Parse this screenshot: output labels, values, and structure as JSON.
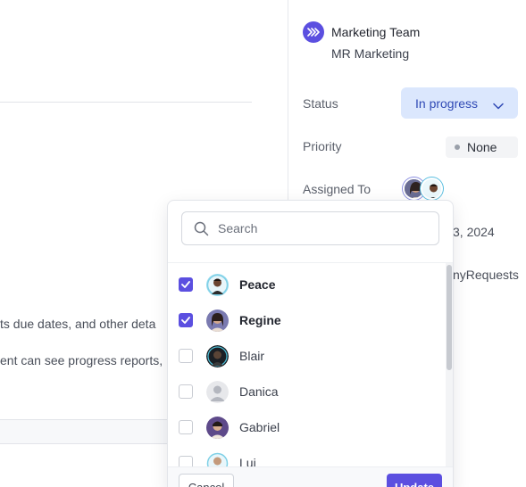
{
  "left": {
    "text_line_1": "ts due dates, and other deta",
    "text_line_2": "ent can see progress reports,"
  },
  "team": {
    "icon": "team-chevrons-icon",
    "name": "Marketing Team",
    "subtitle": "MR Marketing"
  },
  "properties": {
    "status_label": "Status",
    "status_value": "In progress",
    "priority_label": "Priority",
    "priority_value": "None",
    "assigned_label": "Assigned To",
    "date_partial": "3, 2024",
    "requests_partial": "nyRequests"
  },
  "dropdown": {
    "search_placeholder": "Search",
    "members": [
      {
        "name": "Peace",
        "checked": true
      },
      {
        "name": "Regine",
        "checked": true
      },
      {
        "name": "Blair",
        "checked": false
      },
      {
        "name": "Danica",
        "checked": false
      },
      {
        "name": "Gabriel",
        "checked": false
      },
      {
        "name": "Lui",
        "checked": false
      }
    ],
    "cancel_label": "Cancel",
    "update_label": "Update"
  },
  "colors": {
    "accent": "#5b4fe0",
    "status_bg": "#dbe7fd",
    "status_text": "#2f49b5"
  }
}
